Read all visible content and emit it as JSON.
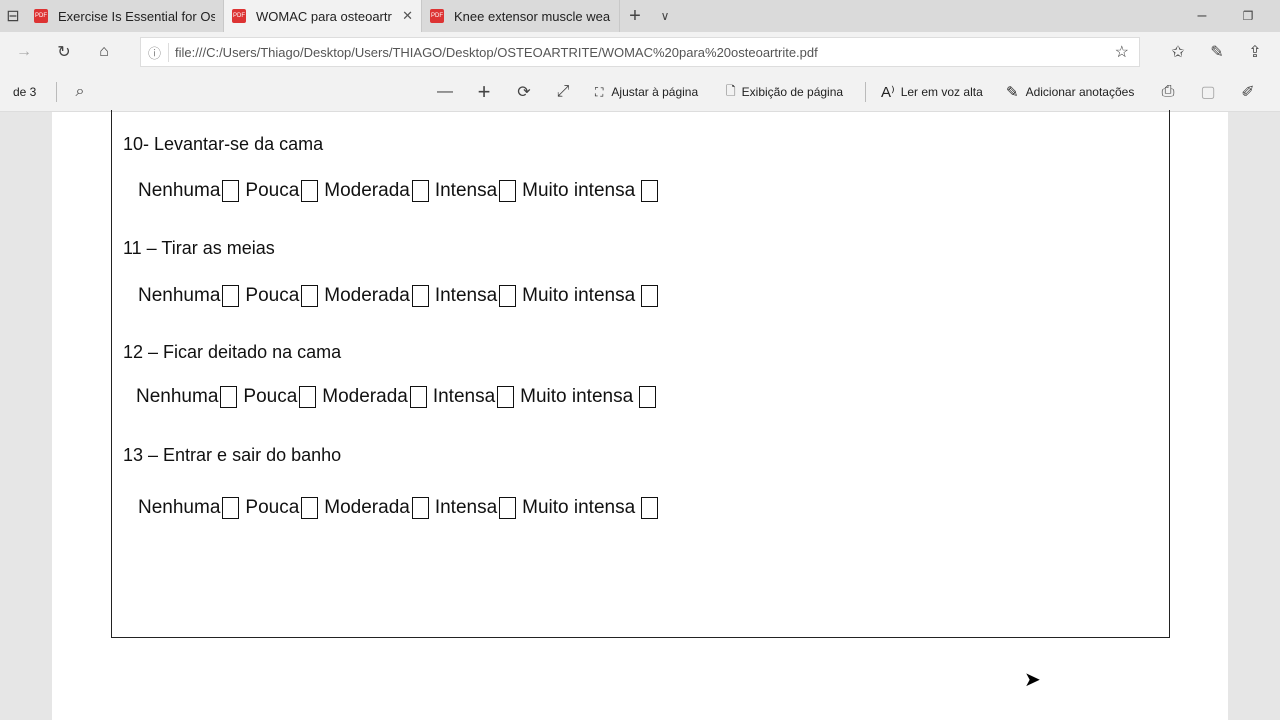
{
  "browser": {
    "tabs": [
      {
        "label": "Exercise Is Essential for Oste",
        "active": false
      },
      {
        "label": "WOMAC para osteoartr",
        "active": true
      },
      {
        "label": "Knee extensor muscle weak",
        "active": false
      }
    ],
    "url": "file:///C:/Users/Thiago/Desktop/Users/THIAGO/Desktop/OSTEOARTRITE/WOMAC%20para%20osteoartrite.pdf"
  },
  "pdf_toolbar": {
    "page_of": "de 3",
    "fit_page": "Ajustar à página",
    "page_view": "Exibição de página",
    "read_aloud": "Ler em voz alta",
    "add_notes": "Adicionar anotações"
  },
  "options": [
    "Nenhuma",
    "Pouca",
    "Moderada",
    "Intensa",
    "Muito intensa"
  ],
  "questions": [
    "10- Levantar-se da cama",
    "11 – Tirar as meias",
    "12 – Ficar deitado na cama",
    "13 – Entrar e sair do banho"
  ]
}
